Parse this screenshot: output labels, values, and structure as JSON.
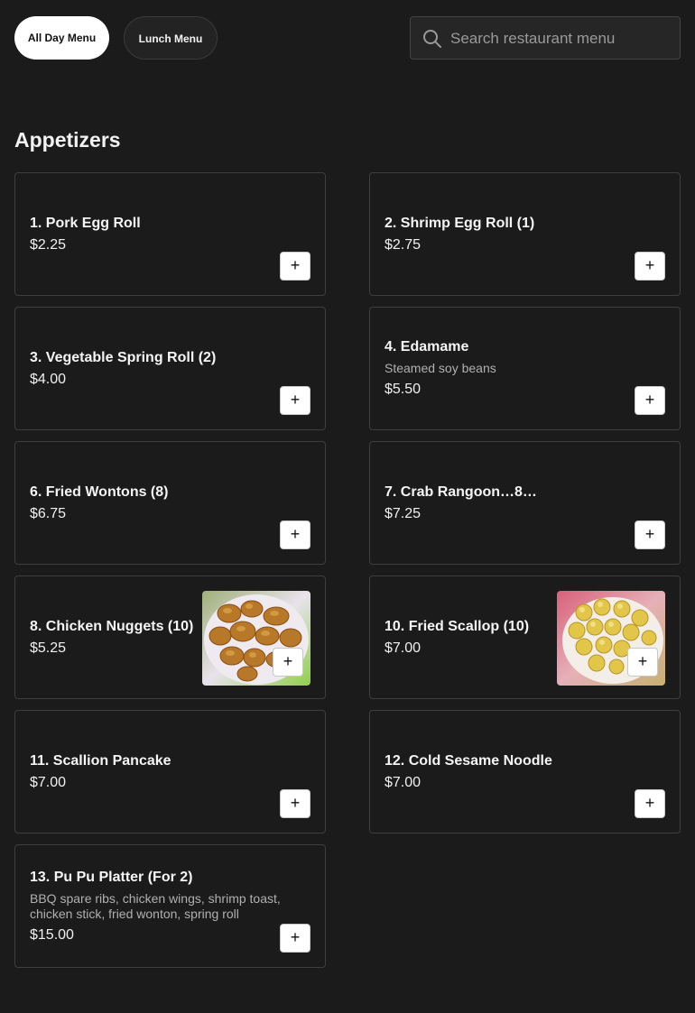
{
  "tabs": [
    {
      "label": "All Day Menu",
      "active": true
    },
    {
      "label": "Lunch Menu",
      "active": false
    }
  ],
  "search": {
    "placeholder": "Search restaurant menu",
    "icon": "search-icon"
  },
  "section": {
    "title": "Appetizers"
  },
  "items": [
    {
      "name": "1. Pork Egg Roll",
      "desc": "",
      "price": "$2.25",
      "image": null
    },
    {
      "name": "2. Shrimp Egg Roll (1)",
      "desc": "",
      "price": "$2.75",
      "image": null
    },
    {
      "name": "3. Vegetable Spring Roll (2)",
      "desc": "",
      "price": "$4.00",
      "image": null
    },
    {
      "name": "4. Edamame",
      "desc": "Steamed soy beans",
      "price": "$5.50",
      "image": null
    },
    {
      "name": "6. Fried Wontons (8)",
      "desc": "",
      "price": "$6.75",
      "image": null
    },
    {
      "name": "7. Crab Rangoon…8…",
      "desc": "",
      "price": "$7.25",
      "image": null
    },
    {
      "name": "8. Chicken Nuggets (10)",
      "desc": "",
      "price": "$5.25",
      "image": "chicken-nuggets-photo"
    },
    {
      "name": "10. Fried Scallop (10)",
      "desc": "",
      "price": "$7.00",
      "image": "fried-scallop-photo"
    },
    {
      "name": "11. Scallion Pancake",
      "desc": "",
      "price": "$7.00",
      "image": null
    },
    {
      "name": "12. Cold Sesame Noodle",
      "desc": "",
      "price": "$7.00",
      "image": null
    },
    {
      "name": "13. Pu Pu Platter (For 2)",
      "desc": "BBQ spare ribs, chicken wings, shrimp toast, chicken stick, fried wonton, spring roll",
      "price": "$15.00",
      "image": null
    }
  ],
  "add_label": "+",
  "colors": {
    "background": "#1b1b1b",
    "card_border": "#3e3e3e",
    "active_pill": "#ffffff",
    "text": "#f2f2f2",
    "muted": "#b0b0b0"
  }
}
